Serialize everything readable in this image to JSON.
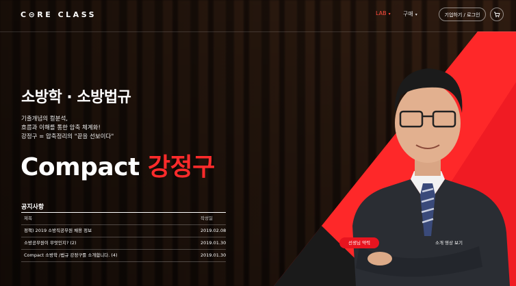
{
  "header": {
    "logo": "C⊝RE CLASS",
    "nav": [
      {
        "label": "LAB",
        "caret": "▾"
      },
      {
        "label": "구매",
        "caret": "▾"
      }
    ],
    "login_label": "기업하기 / 로그인",
    "cart_icon": "cart-icon"
  },
  "hero": {
    "title": "소방학 · 소방법규",
    "subtitle_lines": [
      "기출개념의 컬분석,",
      "흐름과 이해를 통한 암축 체계화!",
      "강정구 = 압축정리의 \"끝을 선보이다\""
    ],
    "compact_word": "Compact",
    "compact_name": "강정구",
    "buttons": {
      "teacher": "선생님 약력",
      "video": "소개 영상 보기"
    }
  },
  "notice": {
    "title": "공지사항",
    "columns": [
      "제목",
      "작성일"
    ],
    "rows": [
      {
        "title": "정책) 2019 소방직공무원 채용 정보",
        "date": "2019.02.08"
      },
      {
        "title": "소방공무원이 무엇인지? (2)",
        "date": "2019.01.30"
      },
      {
        "title": "Compact 소방학 /법규 강정구를 소개합니다. (4)",
        "date": "2019.01.30"
      }
    ]
  },
  "colors": {
    "accent_red": "#e8141f",
    "nav_active": "#ff4a3d"
  }
}
